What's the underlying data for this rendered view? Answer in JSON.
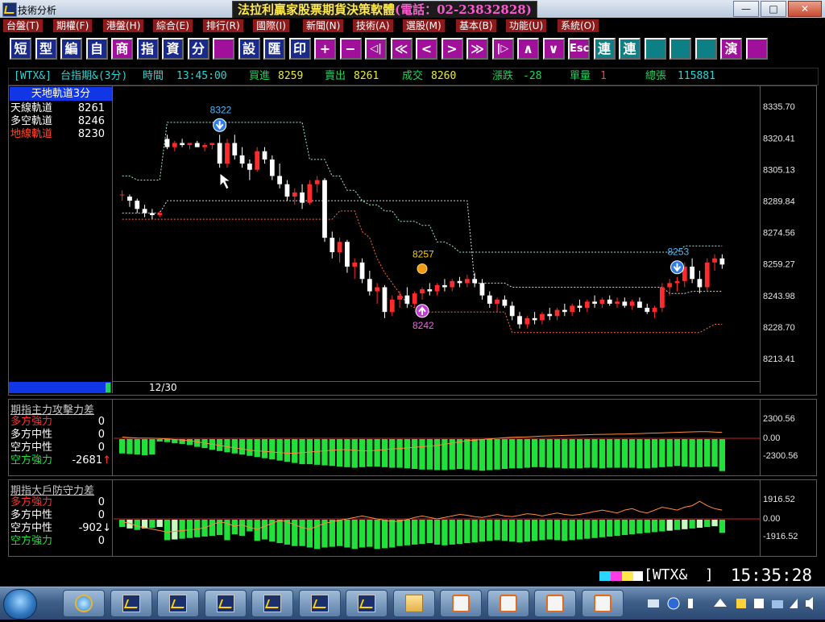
{
  "window": {
    "title": "技術分析",
    "brand": "法拉利贏家股票期貨決策軟體",
    "phone": "(電話：02-23832828)",
    "buttons": {
      "minimize": "—",
      "maximize": "□",
      "close": "✕"
    }
  },
  "menu": [
    "台盤(T)",
    "期權(F)",
    "港盤(H)",
    "綜合(E)",
    "排行(R)",
    "國際(I)",
    "新聞(N)",
    "技術(A)",
    "選股(M)",
    "基本(B)",
    "功能(U)",
    "系統(O)"
  ],
  "toolbar": [
    {
      "label": "短",
      "style": "blue"
    },
    {
      "label": "型",
      "style": "blue"
    },
    {
      "label": "編",
      "style": "blue"
    },
    {
      "label": "自",
      "style": "blue"
    },
    {
      "label": "商",
      "style": "mag"
    },
    {
      "label": "指",
      "style": "blue"
    },
    {
      "label": "資",
      "style": "blue"
    },
    {
      "label": "分",
      "style": "blue"
    },
    {
      "label": "",
      "style": "mag"
    },
    {
      "label": "設",
      "style": "blue"
    },
    {
      "label": "匯",
      "style": "blue"
    },
    {
      "label": "印",
      "style": "blue"
    },
    {
      "label": "+",
      "style": "mag"
    },
    {
      "label": "−",
      "style": "mag"
    },
    {
      "label": "◁|",
      "style": "mag"
    },
    {
      "label": "≪",
      "style": "mag"
    },
    {
      "label": "<",
      "style": "mag"
    },
    {
      "label": ">",
      "style": "mag"
    },
    {
      "label": "≫",
      "style": "mag"
    },
    {
      "label": "|▷",
      "style": "mag"
    },
    {
      "label": "∧",
      "style": "mag"
    },
    {
      "label": "∨",
      "style": "mag"
    },
    {
      "label": "Esc",
      "style": "mag"
    },
    {
      "label": "連",
      "style": "teal"
    },
    {
      "label": "連",
      "style": "teal"
    },
    {
      "label": "",
      "style": "teal"
    },
    {
      "label": "",
      "style": "teal"
    },
    {
      "label": "",
      "style": "teal"
    },
    {
      "label": "演",
      "style": "mag"
    },
    {
      "label": "",
      "style": "mag"
    }
  ],
  "quote": {
    "symbol": "[WTX&]",
    "name": "台指期&(3分)",
    "time_label": "時間",
    "time": "13:45:00",
    "bid_label": "買進",
    "bid": "8259",
    "ask_label": "賣出",
    "ask": "8261",
    "last_label": "成交",
    "last": "8260",
    "change_label": "漲跌",
    "change": "-28",
    "volume_label": "單量",
    "volume": "1",
    "total_label": "總張",
    "total": "115881"
  },
  "price_panel": {
    "title": "天地軌道3分",
    "legend": [
      {
        "label": "天線軌道",
        "value": "8261",
        "color": "#ffffff"
      },
      {
        "label": "多空軌道",
        "value": "8246",
        "color": "#ffffff"
      },
      {
        "label": "地線軌道",
        "value": "8230",
        "color": "#ff4a2a"
      }
    ],
    "date": "12/30",
    "annotations": [
      {
        "text": "8322",
        "color": "#46b8ff",
        "kind": "down-marker"
      },
      {
        "text": "8257",
        "color": "#ffcc00",
        "kind": "dot"
      },
      {
        "text": "8242",
        "color": "#ff5af0",
        "kind": "up-marker"
      },
      {
        "text": "8253",
        "color": "#46b8ff",
        "kind": "down-marker"
      }
    ]
  },
  "panel2": {
    "title": "期指主力攻擊力差",
    "legend": [
      {
        "label": "多方強力",
        "value": "0",
        "color": "#ff3030"
      },
      {
        "label": "多方中性",
        "value": "0",
        "color": "#ffffff"
      },
      {
        "label": "空方中性",
        "value": "0",
        "color": "#ffffff"
      },
      {
        "label": "空方強力",
        "value": "-2681",
        "color": "#22e03a",
        "arrow": "↑",
        "arrow_color": "#ff3030"
      }
    ],
    "axis": [
      "2300.56",
      "0.00",
      "-2300.56"
    ]
  },
  "panel3": {
    "title": "期指大戶防守力差",
    "legend": [
      {
        "label": "多方強力",
        "value": "0",
        "color": "#ff3030"
      },
      {
        "label": "多方中性",
        "value": "0",
        "color": "#ffffff"
      },
      {
        "label": "空方中性",
        "value": "-902",
        "color": "#ffffff",
        "arrow": "↓",
        "arrow_color": "#ffffff"
      },
      {
        "label": "空方強力",
        "value": "0",
        "color": "#22e03a"
      }
    ],
    "axis": [
      "1916.52",
      "0.00",
      "-1916.52"
    ]
  },
  "chart_data": {
    "type": "candlestick",
    "title": "天地軌道3分",
    "y_ticks": [
      "8335.70",
      "8320.41",
      "8305.13",
      "8289.84",
      "8274.56",
      "8259.27",
      "8243.98",
      "8228.70",
      "8213.41"
    ],
    "ylim": [
      8204,
      8344
    ],
    "x_label": "12/30",
    "grid": false,
    "candles": [
      [
        8293,
        8295,
        8290,
        8293
      ],
      [
        8292,
        8293,
        8287,
        8290
      ],
      [
        8290,
        8291,
        8284,
        8286
      ],
      [
        8286,
        8288,
        8282,
        8284
      ],
      [
        8284,
        8286,
        8281,
        8283
      ],
      [
        8283,
        8285,
        8282,
        8284
      ],
      [
        8320,
        8322,
        8315,
        8316
      ],
      [
        8316,
        8319,
        8314,
        8318
      ],
      [
        8318,
        8320,
        8316,
        8317
      ],
      [
        8317,
        8318,
        8315,
        8318
      ],
      [
        8318,
        8319,
        8316,
        8316
      ],
      [
        8316,
        8318,
        8314,
        8317
      ],
      [
        8317,
        8318,
        8315,
        8318
      ],
      [
        8318,
        8322,
        8306,
        8308
      ],
      [
        8308,
        8320,
        8306,
        8318
      ],
      [
        8318,
        8322,
        8310,
        8312
      ],
      [
        8312,
        8316,
        8306,
        8308
      ],
      [
        8308,
        8310,
        8300,
        8305
      ],
      [
        8305,
        8316,
        8304,
        8314
      ],
      [
        8314,
        8316,
        8308,
        8310
      ],
      [
        8310,
        8312,
        8300,
        8302
      ],
      [
        8302,
        8308,
        8296,
        8298
      ],
      [
        8298,
        8300,
        8290,
        8292
      ],
      [
        8292,
        8296,
        8288,
        8294
      ],
      [
        8294,
        8298,
        8286,
        8289
      ],
      [
        8289,
        8300,
        8288,
        8298
      ],
      [
        8298,
        8302,
        8294,
        8300
      ],
      [
        8300,
        8301,
        8270,
        8272
      ],
      [
        8272,
        8275,
        8262,
        8265
      ],
      [
        8265,
        8272,
        8260,
        8270
      ],
      [
        8270,
        8271,
        8255,
        8258
      ],
      [
        8258,
        8262,
        8252,
        8260
      ],
      [
        8260,
        8262,
        8250,
        8252
      ],
      [
        8252,
        8256,
        8244,
        8246
      ],
      [
        8246,
        8250,
        8240,
        8248
      ],
      [
        8248,
        8249,
        8233,
        8236
      ],
      [
        8236,
        8244,
        8234,
        8242
      ],
      [
        8242,
        8246,
        8238,
        8244
      ],
      [
        8244,
        8248,
        8238,
        8240
      ],
      [
        8240,
        8246,
        8238,
        8245
      ],
      [
        8245,
        8248,
        8242,
        8247
      ],
      [
        8247,
        8250,
        8244,
        8246
      ],
      [
        8246,
        8250,
        8244,
        8249
      ],
      [
        8249,
        8252,
        8246,
        8248
      ],
      [
        8248,
        8252,
        8246,
        8251
      ],
      [
        8251,
        8253,
        8248,
        8250
      ],
      [
        8250,
        8254,
        8248,
        8252
      ],
      [
        8252,
        8255,
        8248,
        8250
      ],
      [
        8250,
        8252,
        8242,
        8244
      ],
      [
        8244,
        8246,
        8238,
        8240
      ],
      [
        8240,
        8243,
        8236,
        8242
      ],
      [
        8242,
        8244,
        8238,
        8239
      ],
      [
        8239,
        8241,
        8232,
        8234
      ],
      [
        8234,
        8236,
        8228,
        8230
      ],
      [
        8230,
        8234,
        8228,
        8233
      ],
      [
        8233,
        8236,
        8230,
        8232
      ],
      [
        8232,
        8236,
        8230,
        8235
      ],
      [
        8235,
        8238,
        8232,
        8234
      ],
      [
        8234,
        8238,
        8232,
        8237
      ],
      [
        8237,
        8240,
        8234,
        8236
      ],
      [
        8236,
        8240,
        8234,
        8239
      ],
      [
        8239,
        8242,
        8236,
        8238
      ],
      [
        8238,
        8242,
        8236,
        8241
      ],
      [
        8241,
        8244,
        8238,
        8240
      ],
      [
        8240,
        8243,
        8238,
        8242
      ],
      [
        8242,
        8244,
        8239,
        8240
      ],
      [
        8240,
        8243,
        8238,
        8241
      ],
      [
        8241,
        8243,
        8238,
        8239
      ],
      [
        8239,
        8242,
        8237,
        8241
      ],
      [
        8241,
        8243,
        8238,
        8238
      ],
      [
        8238,
        8240,
        8235,
        8236
      ],
      [
        8236,
        8239,
        8233,
        8238
      ],
      [
        8238,
        8250,
        8236,
        8248
      ],
      [
        8248,
        8252,
        8244,
        8250
      ],
      [
        8250,
        8253,
        8246,
        8251
      ],
      [
        8251,
        8260,
        8248,
        8258
      ],
      [
        8258,
        8262,
        8250,
        8252
      ],
      [
        8252,
        8256,
        8245,
        8248
      ],
      [
        8248,
        8262,
        8246,
        8260
      ],
      [
        8260,
        8264,
        8256,
        8262
      ],
      [
        8262,
        8264,
        8257,
        8259
      ]
    ],
    "upper_band": [
      8302,
      8302,
      8300,
      8300,
      8300,
      8300,
      8328,
      8328,
      8328,
      8328,
      8328,
      8328,
      8328,
      8328,
      8328,
      8328,
      8328,
      8328,
      8328,
      8328,
      8328,
      8328,
      8328,
      8328,
      8328,
      8310,
      8310,
      8310,
      8302,
      8302,
      8295,
      8295,
      8290,
      8288,
      8288,
      8285,
      8285,
      8280,
      8280,
      8280,
      8278,
      8278,
      8270,
      8270,
      8268,
      8265,
      8265,
      8265,
      8265,
      8265,
      8265,
      8265,
      8265,
      8265,
      8265,
      8265,
      8265,
      8265,
      8265,
      8265,
      8265,
      8265,
      8265,
      8265,
      8265,
      8265,
      8265,
      8265,
      8265,
      8265,
      8265,
      8265,
      8265,
      8265,
      8265,
      8268,
      8268,
      8268,
      8268,
      8268,
      8268
    ],
    "lower_band": [
      8281,
      8281,
      8281,
      8281,
      8281,
      8281,
      8281,
      8281,
      8281,
      8281,
      8281,
      8281,
      8281,
      8281,
      8281,
      8281,
      8281,
      8281,
      8281,
      8281,
      8281,
      8281,
      8281,
      8281,
      8281,
      8281,
      8281,
      8281,
      8281,
      8285,
      8285,
      8285,
      8275,
      8272,
      8262,
      8255,
      8250,
      8245,
      8240,
      8238,
      8236,
      8236,
      8236,
      8236,
      8236,
      8236,
      8236,
      8236,
      8236,
      8236,
      8236,
      8236,
      8226,
      8226,
      8226,
      8226,
      8226,
      8226,
      8226,
      8226,
      8226,
      8226,
      8226,
      8226,
      8226,
      8226,
      8226,
      8226,
      8226,
      8226,
      8226,
      8226,
      8226,
      8226,
      8226,
      8226,
      8226,
      8226,
      8228,
      8230,
      8230
    ],
    "mid_band": [
      8284,
      8284,
      8284,
      8284,
      8284,
      8284,
      8290,
      8290,
      8290,
      8290,
      8290,
      8290,
      8290,
      8290,
      8290,
      8290,
      8290,
      8290,
      8290,
      8290,
      8290,
      8290,
      8290,
      8290,
      8290,
      8290,
      8290,
      8290,
      8290,
      8290,
      8290,
      8290,
      8290,
      8290,
      8290,
      8290,
      8290,
      8290,
      8290,
      8290,
      8290,
      8290,
      8290,
      8290,
      8290,
      8290,
      8290,
      8250,
      8250,
      8250,
      8250,
      8250,
      8248,
      8248,
      8248,
      8248,
      8248,
      8248,
      8248,
      8248,
      8248,
      8248,
      8248,
      8248,
      8248,
      8248,
      8248,
      8248,
      8248,
      8248,
      8248,
      8248,
      8248,
      8245,
      8245,
      8245,
      8246,
      8246,
      8246,
      8246,
      8246
    ],
    "panel2_bars": [
      -1200,
      -1250,
      -1300,
      -1350,
      -1300,
      -200,
      -250,
      -350,
      -400,
      -500,
      -650,
      -750,
      -900,
      -1000,
      -1100,
      -1200,
      -1300,
      -1400,
      -1500,
      -1600,
      -1700,
      -1800,
      -1900,
      -2000,
      -2100,
      -2100,
      -2150,
      -2200,
      -2250,
      -2300,
      -2350,
      -2400,
      -2350,
      -2300,
      -2300,
      -2350,
      -2400,
      -2400,
      -2450,
      -2500,
      -2550,
      -2550,
      -2600,
      -2600,
      -2550,
      -2500,
      -2550,
      -2600,
      -2650,
      -2600,
      -2550,
      -2500,
      -2450,
      -2450,
      -2400,
      -2350,
      -2350,
      -2400,
      -2400,
      -2450,
      -2450,
      -2450,
      -2400,
      -2400,
      -2450,
      -2400,
      -2400,
      -2400,
      -2400,
      -2450,
      -2450,
      -2400,
      -2350,
      -2300,
      -2250,
      -2300,
      -2350,
      -2350,
      -2300,
      -2300,
      -2680
    ],
    "panel2_line": [
      100,
      60,
      30,
      20,
      10,
      -20,
      -50,
      -100,
      -150,
      -200,
      -300,
      -400,
      -500,
      -600,
      -700,
      -800,
      -900,
      -1000,
      -1050,
      -1100,
      -1150,
      -1200,
      -1250,
      -1250,
      -1200,
      -1150,
      -1100,
      -1050,
      -1000,
      -950,
      -950,
      -1000,
      -1050,
      -1050,
      -1000,
      -950,
      -900,
      -850,
      -800,
      -750,
      -700,
      -650,
      -600,
      -500,
      -400,
      -300,
      -200,
      -150,
      -100,
      -50,
      0,
      50,
      80,
      100,
      120,
      150,
      180,
      200,
      220,
      240,
      260,
      280,
      300,
      320,
      330,
      340,
      350,
      360,
      380,
      400,
      420,
      440,
      460,
      480,
      500,
      520,
      540,
      560,
      560,
      520,
      500
    ],
    "panel3_bars": [
      -500,
      -600,
      -700,
      -600,
      -550,
      -500,
      -1400,
      -1350,
      -1300,
      -1250,
      -1200,
      -1150,
      -1100,
      -1050,
      -1400,
      -1000,
      -1100,
      -800,
      -1450,
      -1350,
      -1500,
      -1600,
      -1700,
      -1800,
      -1800,
      -1900,
      -2000,
      -1900,
      -1850,
      -1800,
      -1900,
      -2000,
      -1900,
      -1850,
      -2000,
      -1950,
      -1900,
      -1800,
      -1750,
      -1700,
      -1650,
      -1600,
      -1700,
      -1750,
      -1700,
      -1650,
      -1600,
      -1550,
      -1500,
      -1450,
      -1400,
      -1450,
      -1500,
      -1550,
      -1500,
      -1450,
      -1400,
      -1350,
      -1400,
      -1450,
      -1400,
      -1350,
      -1300,
      -1250,
      -1200,
      -1150,
      -1100,
      -1050,
      -1000,
      -950,
      -900,
      -850,
      -800,
      -750,
      -700,
      -650,
      -600,
      -550,
      -500,
      -450,
      -902
    ],
    "panel3_line": [
      -200,
      -300,
      -500,
      -600,
      -700,
      -800,
      -900,
      -850,
      -800,
      -750,
      -700,
      -600,
      -400,
      -200,
      -300,
      -500,
      -400,
      -600,
      -700,
      -500,
      -300,
      -100,
      -200,
      -400,
      -600,
      -700,
      -500,
      -300,
      -200,
      -100,
      0,
      100,
      200,
      100,
      0,
      -100,
      -200,
      -150,
      -50,
      100,
      200,
      100,
      0,
      100,
      200,
      300,
      250,
      150,
      100,
      200,
      300,
      200,
      150,
      250,
      350,
      300,
      200,
      300,
      400,
      300,
      250,
      300,
      400,
      500,
      600,
      500,
      400,
      600,
      700,
      500,
      400,
      600,
      800,
      700,
      600,
      800,
      900,
      1200,
      900,
      700,
      600
    ]
  },
  "status": {
    "symbol": "WTX&",
    "clock": "15:35:28"
  },
  "taskbar": {
    "apps": [
      "ie",
      "chart",
      "chart",
      "chart",
      "chart",
      "chart",
      "chart",
      "folder",
      "app",
      "app",
      "app",
      "app"
    ]
  }
}
